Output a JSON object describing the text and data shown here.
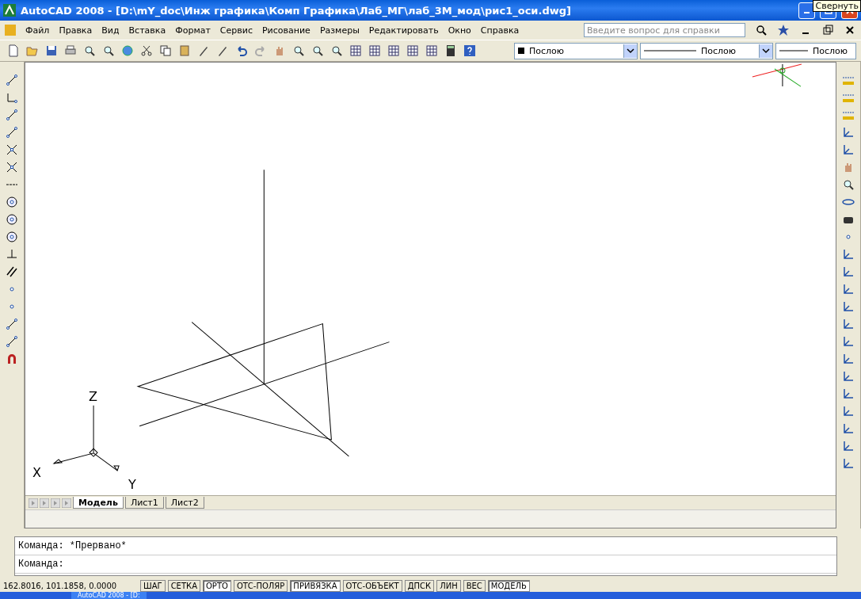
{
  "window": {
    "title": "AutoCAD 2008 - [D:\\mY_doc\\Инж графика\\Комп Графика\\Лаб_МГ\\лаб_3М_мод\\рис1_оси.dwg]",
    "tooltip": "Свернуть"
  },
  "menu": [
    "Файл",
    "Правка",
    "Вид",
    "Вставка",
    "Формат",
    "Сервис",
    "Рисование",
    "Размеры",
    "Редактировать",
    "Окно",
    "Справка"
  ],
  "help_search": {
    "placeholder": "Введите вопрос для справки"
  },
  "properties": [
    {
      "kind": "color",
      "value": "Послою"
    },
    {
      "kind": "linetype",
      "value": "Послою"
    },
    {
      "kind": "lineweight",
      "value": "Послою"
    }
  ],
  "axes": {
    "x": "X",
    "y": "Y",
    "z": "Z"
  },
  "layout_tabs": [
    {
      "label": "Модель",
      "selected": true
    },
    {
      "label": "Лист1",
      "selected": false
    },
    {
      "label": "Лист2",
      "selected": false
    }
  ],
  "command_history": [
    "Команда: *Прервано*"
  ],
  "command_prompt": "Команда:",
  "status_bar": {
    "coordinates": "162.8016, 101.1858, 0.0000",
    "toggles": [
      {
        "label": "ШАГ",
        "on": false
      },
      {
        "label": "СЕТКА",
        "on": false
      },
      {
        "label": "ОРТО",
        "on": true
      },
      {
        "label": "ОТС-ПОЛЯР",
        "on": false
      },
      {
        "label": "ПРИВЯЗКА",
        "on": true
      },
      {
        "label": "ОТС-ОБЪЕКТ",
        "on": false
      },
      {
        "label": "ДПСК",
        "on": false
      },
      {
        "label": "ЛИН",
        "on": false
      },
      {
        "label": "ВЕС",
        "on": false
      },
      {
        "label": "МОДЕЛЬ",
        "on": true
      }
    ]
  },
  "taskbar": {
    "item": "AutoCAD 2008 - [D:"
  }
}
